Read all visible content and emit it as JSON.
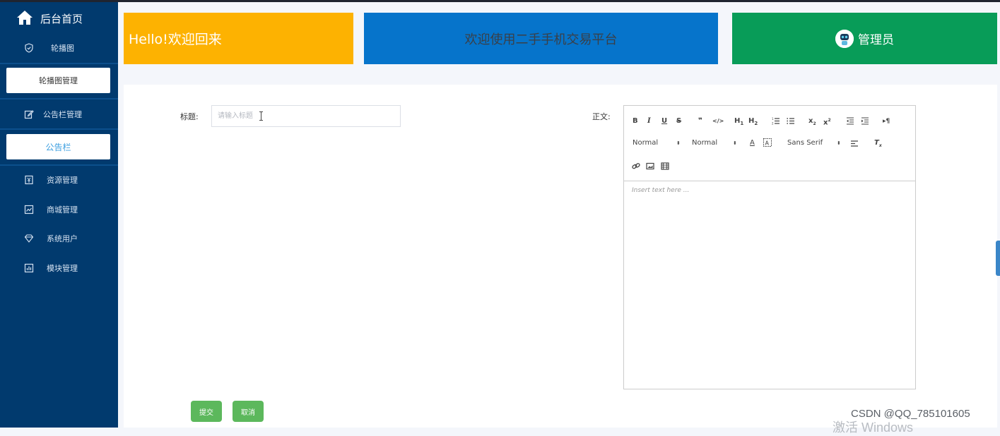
{
  "sidebar": {
    "brand": "后台首页",
    "items": [
      {
        "label": "轮播图",
        "icon": "shield-icon"
      },
      {
        "label": "轮播图管理"
      },
      {
        "label": "公告栏管理",
        "icon": "edit-icon"
      },
      {
        "label": "公告栏"
      },
      {
        "label": "资源管理",
        "icon": "money-icon"
      },
      {
        "label": "商城管理",
        "icon": "chart-line-icon"
      },
      {
        "label": "系统用户",
        "icon": "diamond-icon"
      },
      {
        "label": "模块管理",
        "icon": "bar-chart-icon"
      }
    ]
  },
  "banners": {
    "welcome_back": "Hello!欢迎回来",
    "platform": "欢迎使用二手手机交易平台",
    "admin": "管理员"
  },
  "form": {
    "title_label": "标题:",
    "title_placeholder": "请输入标题",
    "title_value": "",
    "body_label": "正文:",
    "editor": {
      "toolbar": {
        "header_select": "Normal",
        "size_select": "Normal",
        "font_select": "Sans Serif"
      },
      "placeholder": "Insert text here ..."
    },
    "submit_label": "提交",
    "cancel_label": "取消"
  },
  "overlay": {
    "watermark": "CSDN @QQ_785101605",
    "activate": "激活 Windows"
  },
  "colors": {
    "sidebar": "#013a6e",
    "banner_yellow": "#fdb201",
    "banner_blue": "#0674cb",
    "banner_green": "#089c58",
    "button_green": "#5cb85c"
  }
}
